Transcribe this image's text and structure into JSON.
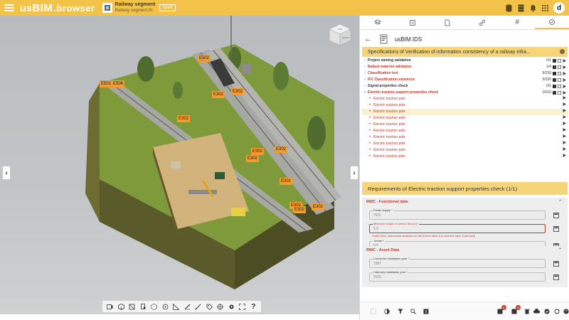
{
  "header": {
    "logo_us": "us",
    "logo_bim": "BIM",
    "logo_browser": ".browser",
    "project_title": "Railway segment",
    "project_file": "Railway segment.ifc",
    "status_badge": "Draft",
    "avatar_initial": "d"
  },
  "viewport": {
    "navcube_top": "TOP",
    "navcube_front": "FRONT",
    "tags": [
      "E502",
      "E502",
      "E506",
      "E302",
      "E302",
      "E302",
      "E302",
      "E302",
      "E302",
      "E301",
      "E302",
      "E302",
      "E302"
    ]
  },
  "panel": {
    "ids_title": "usBIM.IDS",
    "spec_title": "Specifications of Verification of information consistency of a railway infra...",
    "tree": [
      {
        "label": "Project naming validation",
        "stats": "0/1",
        "red": false
      },
      {
        "label": "Ballast material validation",
        "stats": "1/4",
        "red": true
      },
      {
        "label": "Classification test",
        "stats": "9/230",
        "red": true
      },
      {
        "label": "IFC Classification existence",
        "stats": "5/230",
        "red": true
      },
      {
        "label": "Signal properties check",
        "stats": "0/1",
        "red": false
      },
      {
        "label": "Electric traction support properties check",
        "stats": "10/10",
        "red": true
      }
    ],
    "children": [
      "Electric traction pole",
      "Electric traction pole",
      "Electric traction pole",
      "Electric traction pole",
      "Electric traction pole",
      "Electric traction pole",
      "Electric traction pole",
      "Electric traction pole",
      "Electric traction pole",
      "Electric traction pole"
    ],
    "req_title": "Requirements of Electric traction support properties check (1/1)",
    "functional": {
      "title": "RWC - Functional data",
      "power_label": "Power supply *",
      "power_value": "YES",
      "height_label": "Minimum height of contact line [m] *",
      "height_value": "5.5",
      "height_error": "Invalid Value: minInclusive constraint not met (current value: 5.5; expected value: 6 (decimal))",
      "tunnel_label": "Tunnel *",
      "tunnel_value": "NO"
    },
    "asset": {
      "title": "RWC - Asset Data",
      "conductor_label": "Conductor installation year *",
      "conductor_value": "1987",
      "catenary_label": "Catenary installation year *",
      "catenary_value": "2020"
    },
    "badges": {
      "b1": "20",
      "b2": "19"
    }
  },
  "colors": {
    "accent": "#f2c249",
    "section_header": "#f6d57a",
    "error_red": "#c0392b",
    "tag_orange": "#f39b2f"
  }
}
